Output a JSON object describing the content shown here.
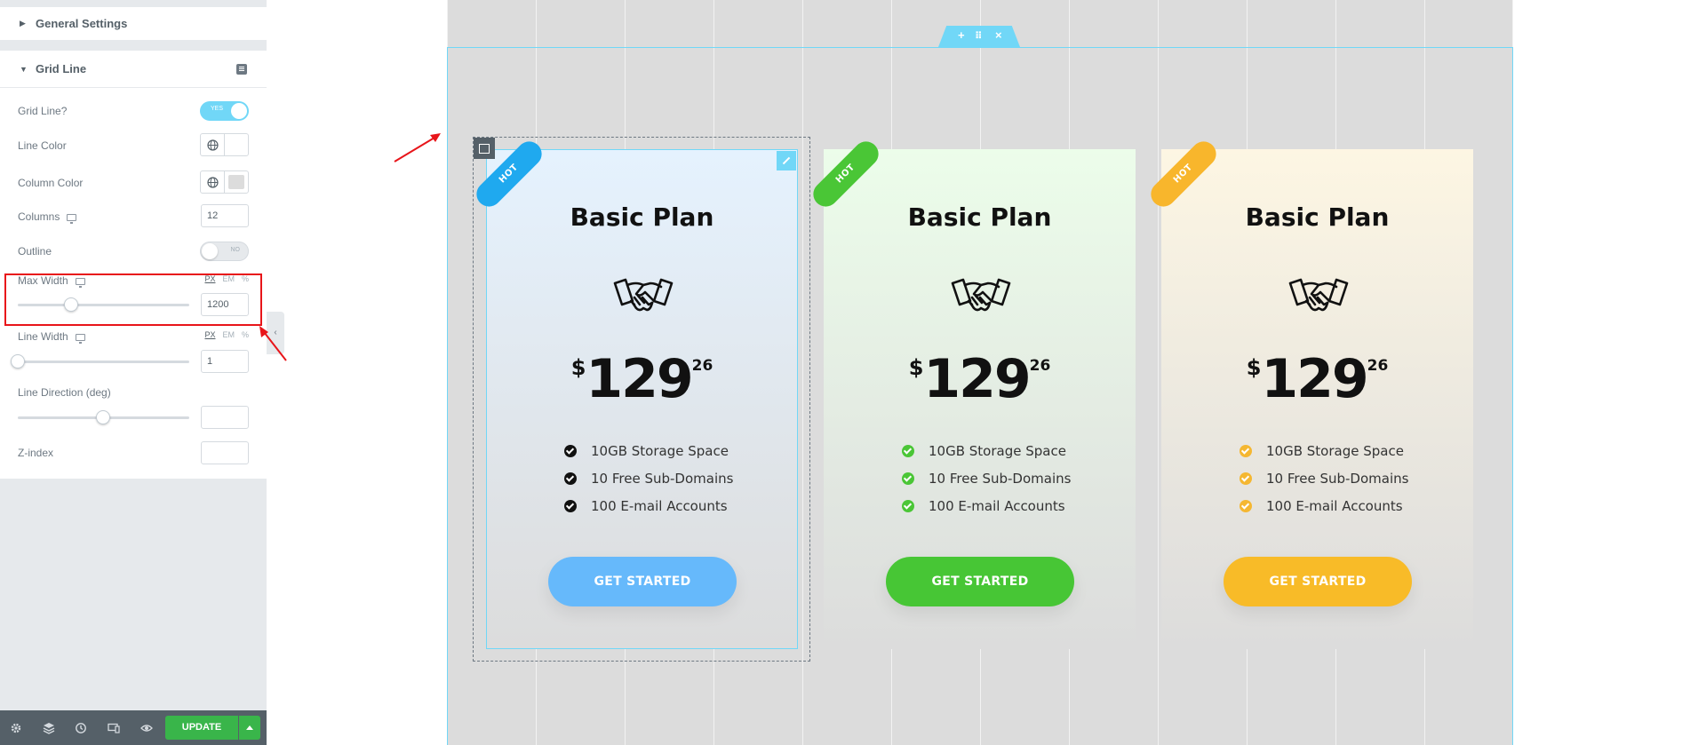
{
  "panel": {
    "section_general": "General Settings",
    "section_grid": "Grid Line",
    "controls": {
      "grid_line": {
        "label": "Grid Line?",
        "toggle_text": "YES"
      },
      "line_color": {
        "label": "Line Color",
        "swatch": "#ffffff"
      },
      "column_color": {
        "label": "Column Color",
        "swatch": "#dcdcdc"
      },
      "columns": {
        "label": "Columns",
        "value": "12"
      },
      "outline": {
        "label": "Outline",
        "toggle_text": "NO"
      },
      "max_width": {
        "label": "Max Width",
        "value": "1200",
        "units": [
          "PX",
          "EM",
          "%"
        ]
      },
      "line_width": {
        "label": "Line Width",
        "value": "1",
        "units": [
          "PX",
          "EM",
          "%"
        ]
      },
      "line_direction": {
        "label": "Line Direction (deg)",
        "value": ""
      },
      "z_index": {
        "label": "Z-index",
        "value": ""
      }
    },
    "footer": {
      "update_label": "UPDATE"
    }
  },
  "section_handle": {
    "add": "+",
    "move": "⠿",
    "close": "×"
  },
  "cards": [
    {
      "ribbon": "HOT",
      "title": "Basic Plan",
      "currency": "$",
      "amount": "129",
      "cents": "26",
      "features": [
        "10GB Storage Space",
        "10 Free Sub-Domains",
        "100 E-mail Accounts"
      ],
      "button": "GET STARTED",
      "accent": "#1fa9ef",
      "check_color": "#111111",
      "button_color": "#66b9fb"
    },
    {
      "ribbon": "HOT",
      "title": "Basic Plan",
      "currency": "$",
      "amount": "129",
      "cents": "26",
      "features": [
        "10GB Storage Space",
        "10 Free Sub-Domains",
        "100 E-mail Accounts"
      ],
      "button": "GET STARTED",
      "accent": "#4ac636",
      "check_color": "#4ac636",
      "button_color": "#47c635"
    },
    {
      "ribbon": "HOT",
      "title": "Basic Plan",
      "currency": "$",
      "amount": "129",
      "cents": "26",
      "features": [
        "10GB Storage Space",
        "10 Free Sub-Domains",
        "100 E-mail Accounts"
      ],
      "button": "GET STARTED",
      "accent": "#f8b62c",
      "check_color": "#f5b731",
      "button_color": "#f8bb28"
    }
  ],
  "colors": {
    "selection": "#71d7f7",
    "annotation_red": "#e8151a",
    "update_green": "#39b54a"
  }
}
